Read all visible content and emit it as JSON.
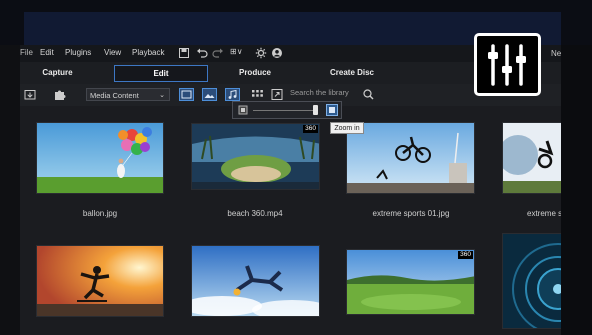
{
  "menubar": {
    "items": [
      "File",
      "Edit",
      "Plugins",
      "View",
      "Playback"
    ],
    "zoom_readout": "⊞∨",
    "right_label": "Ne"
  },
  "tabs": [
    {
      "label": "Capture"
    },
    {
      "label": "Edit"
    },
    {
      "label": "Produce"
    },
    {
      "label": "Create Disc"
    }
  ],
  "toolbar": {
    "dropdown_value": "Media Content",
    "search_placeholder": "Search the library"
  },
  "tooltip": {
    "text": "Zoom in"
  },
  "colors": {
    "accent": "#3d77c4",
    "selected_icon": "#4d8ed8"
  },
  "library": {
    "items": [
      {
        "caption": "ballon.jpg",
        "badge": ""
      },
      {
        "caption": "beach 360.mp4",
        "badge": "360"
      },
      {
        "caption": "extreme sports 01.jpg",
        "badge": ""
      },
      {
        "caption": "extreme s",
        "badge": ""
      },
      {
        "caption": "",
        "badge": ""
      },
      {
        "caption": "",
        "badge": ""
      },
      {
        "caption": "",
        "badge": "360"
      },
      {
        "caption": "",
        "badge": ""
      }
    ]
  }
}
